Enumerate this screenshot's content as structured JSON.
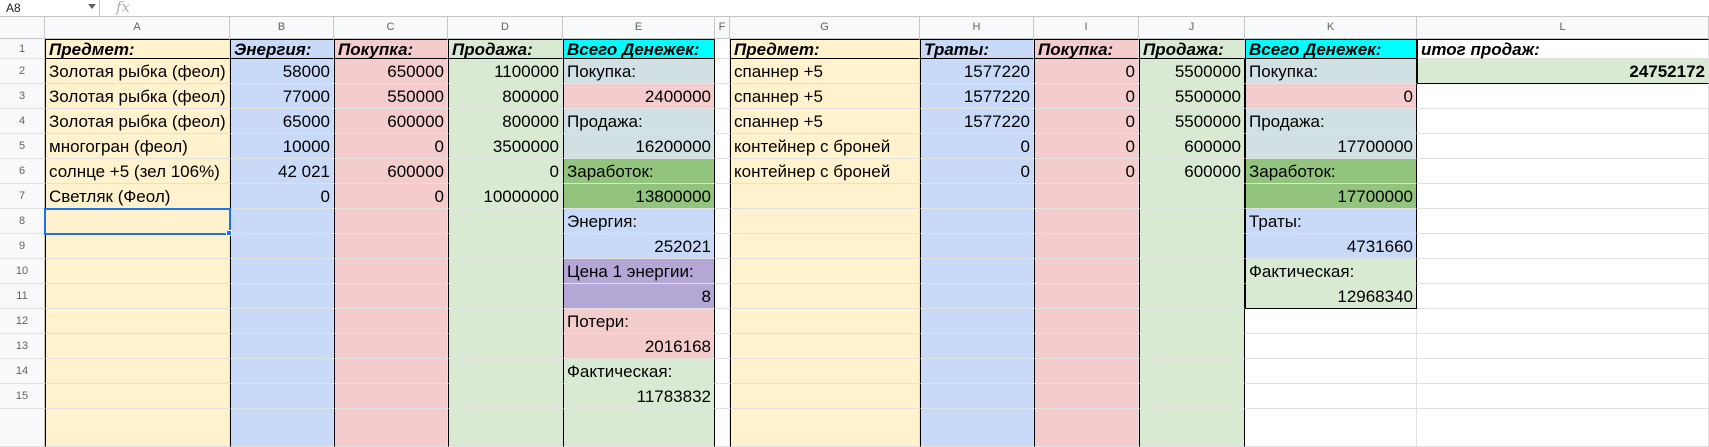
{
  "formula_bar": {
    "cell_ref": "A8",
    "fx_label": "fx",
    "formula_value": ""
  },
  "columns": [
    "A",
    "B",
    "C",
    "D",
    "E",
    "F",
    "G",
    "H",
    "I",
    "J",
    "K",
    "L"
  ],
  "rows": [
    "1",
    "2",
    "3",
    "4",
    "5",
    "6",
    "7",
    "8",
    "9",
    "10",
    "11",
    "12",
    "13",
    "14",
    "15"
  ],
  "colors": {
    "cream": "#fff2cc",
    "blue": "#c9daf8",
    "red": "#f4cccc",
    "green": "#d9ead3",
    "cyan": "#00ffff",
    "teal_gray": "#d0e0e3",
    "dark_green": "#93c47d",
    "purple": "#b4a7d6",
    "selection": "#1a73e8"
  },
  "table1": {
    "headers": {
      "item": "Предмет:",
      "energy": "Энергия:",
      "buy": "Покупка:",
      "sell": "Продажа:",
      "total": "Всего Денежек:"
    },
    "rows": [
      {
        "item": "Золотая рыбка (феол)",
        "energy": "58000",
        "buy": "650000",
        "sell": "1100000"
      },
      {
        "item": "Золотая рыбка (феол)",
        "energy": "77000",
        "buy": "550000",
        "sell": "800000"
      },
      {
        "item": "Золотая рыбка (феол)",
        "energy": "65000",
        "buy": "600000",
        "sell": "800000"
      },
      {
        "item": "многогран (феол)",
        "energy": "10000",
        "buy": "0",
        "sell": "3500000"
      },
      {
        "item": "солнце +5 (зел 106%)",
        "energy": "42 021",
        "buy": "600000",
        "sell": "0"
      },
      {
        "item": "Светляк (Феол)",
        "energy": "0",
        "buy": "0",
        "sell": "10000000"
      }
    ],
    "summary": {
      "buy_label": "Покупка:",
      "buy_value": "2400000",
      "sell_label": "Продажа:",
      "sell_value": "16200000",
      "profit_label": "Заработок:",
      "profit_value": "13800000",
      "energy_label": "Энергия:",
      "energy_value": "252021",
      "price_label": "Цена 1 энергии:",
      "price_value": "8",
      "loss_label": "Потери:",
      "loss_value": "2016168",
      "actual_label": "Фактическая:",
      "actual_value": "11783832"
    }
  },
  "table2": {
    "headers": {
      "item": "Предмет:",
      "spend": "Траты:",
      "buy": "Покупка:",
      "sell": "Продажа:",
      "total": "Всего Денежек:"
    },
    "rows": [
      {
        "item": "спаннер +5",
        "spend": "1577220",
        "buy": "0",
        "sell": "5500000"
      },
      {
        "item": "спаннер +5",
        "spend": "1577220",
        "buy": "0",
        "sell": "5500000"
      },
      {
        "item": "спаннер +5",
        "spend": "1577220",
        "buy": "0",
        "sell": "5500000"
      },
      {
        "item": "контейнер с броней",
        "spend": "0",
        "buy": "0",
        "sell": "600000"
      },
      {
        "item": "контейнер с броней",
        "spend": "0",
        "buy": "0",
        "sell": "600000"
      }
    ],
    "summary": {
      "buy_label": "Покупка:",
      "buy_value": "0",
      "sell_label": "Продажа:",
      "sell_value": "17700000",
      "profit_label": "Заработок:",
      "profit_value": "17700000",
      "spend_label": "Траты:",
      "spend_value": "4731660",
      "actual_label": "Фактическая:",
      "actual_value": "12968340"
    }
  },
  "sales_total": {
    "label": "итог продаж:",
    "value": "24752172"
  }
}
